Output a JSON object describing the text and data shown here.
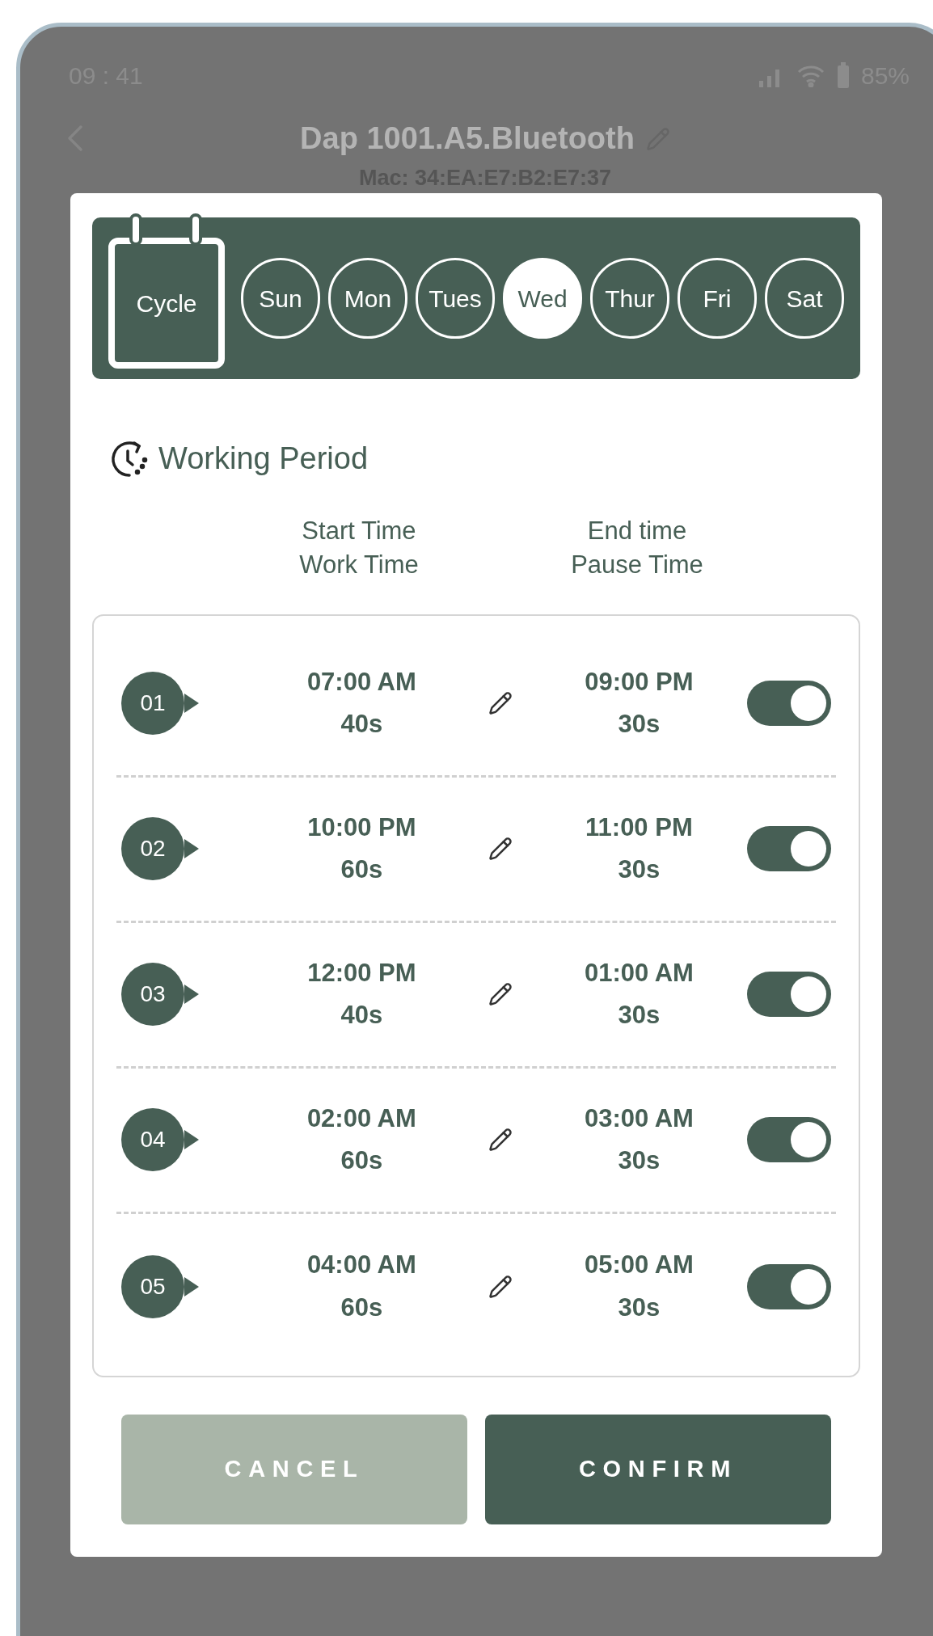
{
  "status_bar": {
    "time": "09 : 41",
    "battery": "85%"
  },
  "header": {
    "title": "Dap 1001.A5.Bluetooth",
    "subtitle": "Mac: 34:EA:E7:B2:E7:37"
  },
  "cycle": {
    "label": "Cycle",
    "days": [
      {
        "label": "Sun",
        "selected": false
      },
      {
        "label": "Mon",
        "selected": false
      },
      {
        "label": "Tues",
        "selected": false
      },
      {
        "label": "Wed",
        "selected": true
      },
      {
        "label": "Thur",
        "selected": false
      },
      {
        "label": "Fri",
        "selected": false
      },
      {
        "label": "Sat",
        "selected": false
      }
    ]
  },
  "section_title": "Working Period",
  "columns": [
    {
      "line_1": "Start Time",
      "line_2": "Work Time"
    },
    {
      "line_1": "End time",
      "line_2": "Pause Time"
    }
  ],
  "periods": [
    {
      "number": "01",
      "start_time": "07:00 AM",
      "work_time": "40s",
      "end_time": "09:00 PM",
      "pause_time": "30s",
      "on": true
    },
    {
      "number": "02",
      "start_time": "10:00  PM",
      "work_time": "60s",
      "end_time": "11:00 PM",
      "pause_time": "30s",
      "on": true
    },
    {
      "number": "03",
      "start_time": "12:00  PM",
      "work_time": "40s",
      "end_time": "01:00 AM",
      "pause_time": "30s",
      "on": true
    },
    {
      "number": "04",
      "start_time": "02:00 AM",
      "work_time": "60s",
      "end_time": "03:00 AM",
      "pause_time": "30s",
      "on": true
    },
    {
      "number": "05",
      "start_time": "04:00 AM",
      "work_time": "60s",
      "end_time": "05:00 AM",
      "pause_time": "30s",
      "on": true
    }
  ],
  "buttons": [
    {
      "label": "CANCEL",
      "kind": "secondary"
    },
    {
      "label": "CONFIRM",
      "kind": "primary"
    }
  ]
}
